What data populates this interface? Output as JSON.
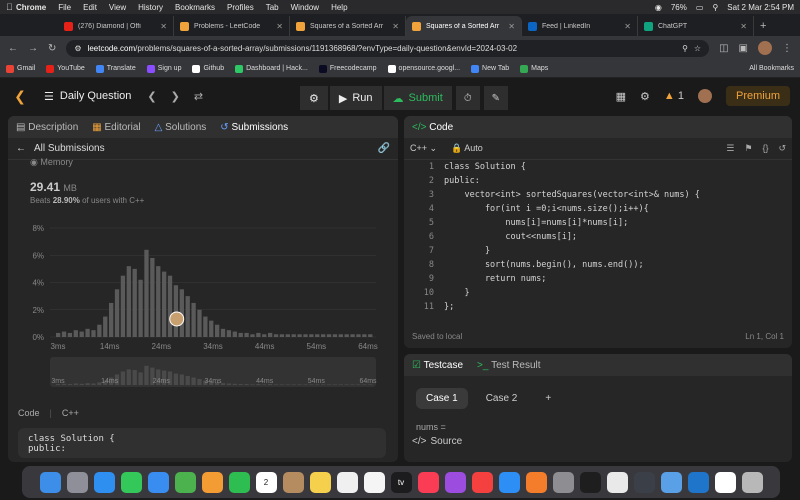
{
  "menubar": {
    "app": "Chrome",
    "items": [
      "File",
      "Edit",
      "View",
      "History",
      "Bookmarks",
      "Profiles",
      "Tab",
      "Window",
      "Help"
    ],
    "battery": "76%",
    "datetime": "Sat 2 Mar  2:54 PM"
  },
  "browser_tabs": [
    {
      "title": "(276) Diamond | Offi",
      "color": "#e62117"
    },
    {
      "title": "Problems - LeetCode",
      "color": "#f0a33b"
    },
    {
      "title": "Squares of a Sorted Arr",
      "color": "#f0a33b"
    },
    {
      "title": "Squares of a Sorted Arr",
      "color": "#f0a33b"
    },
    {
      "title": "Feed | LinkedIn",
      "color": "#0a66c2"
    },
    {
      "title": "ChatGPT",
      "color": "#10a37f"
    }
  ],
  "address": {
    "host": "leetcode.com",
    "path": "/problems/squares-of-a-sorted-array/submissions/1191368968/?envType=daily-question&envId=2024-03-02"
  },
  "bookmarks": [
    {
      "label": "Gmail",
      "color": "#ea4335"
    },
    {
      "label": "YouTube",
      "color": "#e62117"
    },
    {
      "label": "Translate",
      "color": "#4285f4"
    },
    {
      "label": "Sign up",
      "color": "#8a4dff"
    },
    {
      "label": "Github",
      "color": "#ffffff"
    },
    {
      "label": "Dashboard | Hack...",
      "color": "#2ec866"
    },
    {
      "label": "Freecodecamp",
      "color": "#0a0a23"
    },
    {
      "label": "opensource.googl...",
      "color": "#ffffff"
    },
    {
      "label": "New Tab",
      "color": "#4285f4"
    },
    {
      "label": "Maps",
      "color": "#34a853"
    }
  ],
  "all_bookmarks": "All Bookmarks",
  "leetcode": {
    "daily": "Daily Question",
    "run": "Run",
    "submit": "Submit",
    "streak": "1",
    "premium": "Premium"
  },
  "left_panel": {
    "tabs": [
      "Description",
      "Editorial",
      "Solutions",
      "Submissions"
    ],
    "all_submissions": "All Submissions",
    "memory_label": "Memory",
    "memory_value": "29.41",
    "memory_unit": "MB",
    "beats_prefix": "Beats",
    "beats_pct": "28.90%",
    "beats_suffix": "of users with C++",
    "code_label": "Code",
    "code_lang": "C++",
    "code_preview_1": "class Solution {",
    "code_preview_2": "public:"
  },
  "chart_data": {
    "type": "bar",
    "xlabel": "",
    "ylabel": "",
    "y_ticks": [
      "8%",
      "6%",
      "4%",
      "2%",
      "0%"
    ],
    "ylim": [
      0,
      8
    ],
    "x_ticks": [
      "3ms",
      "14ms",
      "24ms",
      "34ms",
      "44ms",
      "54ms",
      "64ms"
    ],
    "values": [
      0.3,
      0.4,
      0.3,
      0.5,
      0.4,
      0.6,
      0.5,
      0.9,
      1.5,
      2.5,
      3.5,
      4.5,
      5.2,
      5.0,
      4.2,
      6.4,
      5.8,
      5.2,
      4.8,
      4.5,
      3.8,
      3.5,
      3.0,
      2.5,
      2.0,
      1.5,
      1.2,
      0.9,
      0.6,
      0.5,
      0.4,
      0.3,
      0.3,
      0.2,
      0.3,
      0.2,
      0.3,
      0.2,
      0.2,
      0.2,
      0.2,
      0.2,
      0.2,
      0.2,
      0.2,
      0.2,
      0.2,
      0.2,
      0.2,
      0.2,
      0.2,
      0.2,
      0.2,
      0.2
    ],
    "grid": true
  },
  "editor": {
    "title": "Code",
    "lang": "C++",
    "mode": "Auto",
    "saved": "Saved to local",
    "cursor": "Ln 1, Col 1",
    "lines": [
      "class Solution {",
      "public:",
      "    vector<int> sortedSquares(vector<int>& nums) {",
      "        for(int i =0;i<nums.size();i++){",
      "            nums[i]=nums[i]*nums[i];",
      "            cout<<nums[i];",
      "        }",
      "        sort(nums.begin(), nums.end());",
      "        return nums;",
      "    }",
      "};"
    ]
  },
  "testcase": {
    "tab1": "Testcase",
    "tab2": "Test Result",
    "case1": "Case 1",
    "case2": "Case 2",
    "add": "+",
    "nums_label": "nums =",
    "source": "Source"
  },
  "dock": [
    {
      "label": "Finder",
      "color": "#3d8ee8"
    },
    {
      "label": "Launchpad",
      "color": "#8f8f99"
    },
    {
      "label": "Safari",
      "color": "#2f8ff0"
    },
    {
      "label": "Messages",
      "color": "#34c759"
    },
    {
      "label": "Mail",
      "color": "#3a8df0"
    },
    {
      "label": "Maps",
      "color": "#4cb24e"
    },
    {
      "label": "Photos",
      "color": "#f39c33"
    },
    {
      "label": "FaceTime",
      "color": "#2dbd50"
    },
    {
      "label": "Calendar",
      "color": "#ffffff",
      "text": "2"
    },
    {
      "label": "Contacts",
      "color": "#b58b60"
    },
    {
      "label": "Notes",
      "color": "#f5d04c"
    },
    {
      "label": "Reminders",
      "color": "#f0f0f0"
    },
    {
      "label": "Freeform",
      "color": "#f5f5f5"
    },
    {
      "label": "TV",
      "color": "#1c1c1e",
      "text": "tv"
    },
    {
      "label": "Music",
      "color": "#fa3c55"
    },
    {
      "label": "Podcasts",
      "color": "#9d4ce0"
    },
    {
      "label": "News",
      "color": "#f54040"
    },
    {
      "label": "App Store",
      "color": "#2d8ef5"
    },
    {
      "label": "Pages",
      "color": "#f37d2a"
    },
    {
      "label": "Settings",
      "color": "#8d8d92"
    },
    {
      "label": "Terminal",
      "color": "#1e1e1e"
    },
    {
      "label": "Chrome",
      "color": "#e9e9e9"
    },
    {
      "label": "Quick",
      "color": "#3a3f48"
    },
    {
      "label": "Preview",
      "color": "#5aa0e6"
    },
    {
      "label": "VSCode",
      "color": "#1e75c9"
    },
    {
      "label": "Files",
      "color": "#ffffff"
    },
    {
      "label": "Trash",
      "color": "#b8b8b8"
    }
  ]
}
